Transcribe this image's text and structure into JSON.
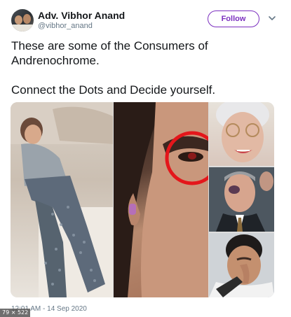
{
  "author": {
    "name": "Adv. Vibhor Anand",
    "handle": "@vibhor_anand",
    "follow_label": "Follow"
  },
  "tweet": {
    "line1": "These are some of the Consumers of",
    "line2": "Andrenochrome.",
    "line3": "Connect the Dots and Decide yourself.",
    "timestamp": "12:01 AM - 14 Sep 2020"
  },
  "overlay": {
    "dimension_badge": "79 × 522"
  },
  "colors": {
    "accent": "#7b2fbf",
    "text": "#14171a",
    "muted": "#657786",
    "highlight_circle": "#e4161b"
  }
}
